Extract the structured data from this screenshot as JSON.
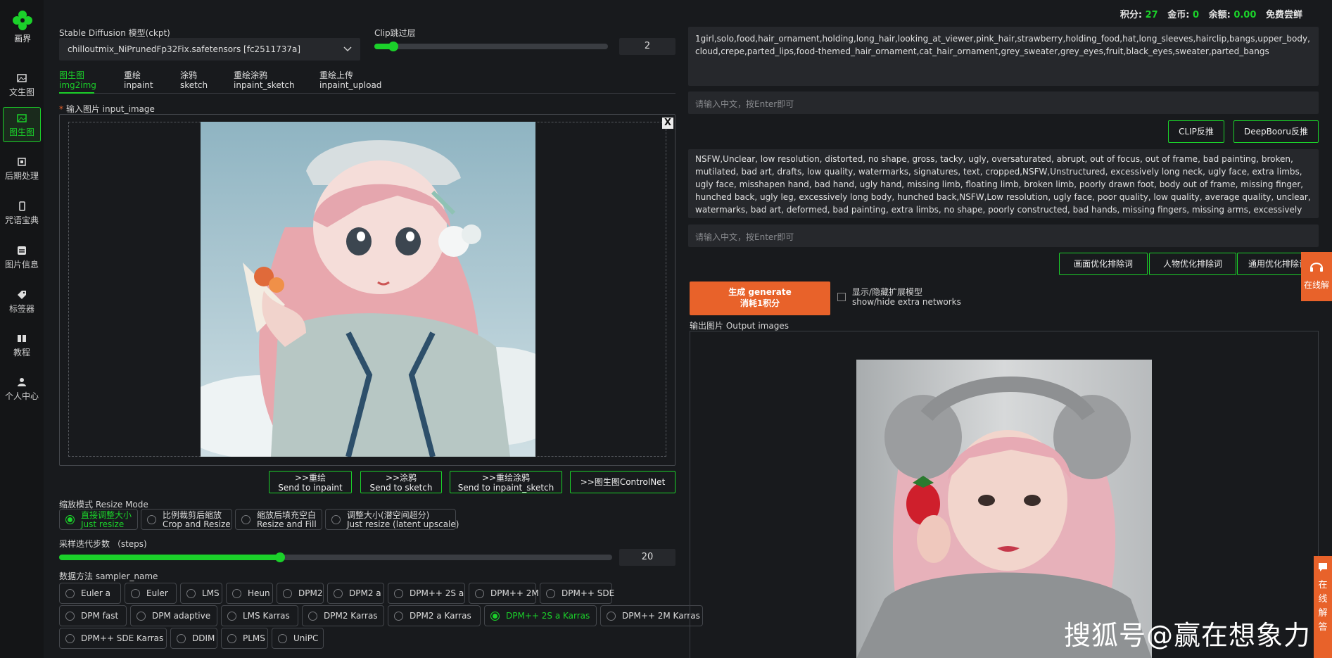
{
  "app": {
    "logo_text": "画界"
  },
  "sidebar": {
    "items": [
      {
        "label": "文生图",
        "icon": "image-icon"
      },
      {
        "label": "图生图",
        "icon": "image-icon",
        "active": true
      },
      {
        "label": "后期处理",
        "icon": "square-icon"
      },
      {
        "label": "咒语宝典",
        "icon": "phone-icon"
      },
      {
        "label": "图片信息",
        "icon": "layers-icon"
      },
      {
        "label": "标签器",
        "icon": "tag-icon"
      },
      {
        "label": "教程",
        "icon": "book-icon"
      },
      {
        "label": "个人中心",
        "icon": "user-icon"
      }
    ]
  },
  "topbar": {
    "points_label": "积分:",
    "points_value": "27",
    "gold_label": "金币:",
    "gold_value": "0",
    "balance_label": "余额:",
    "balance_value": "0.00",
    "free_trial": "免费尝鲜"
  },
  "model": {
    "label": "Stable Diffusion 模型(ckpt)",
    "value": "chilloutmix_NiPrunedFp32Fix.safetensors [fc2511737a]"
  },
  "clip": {
    "label": "Clip跳过层",
    "value": "2",
    "fraction": 0.08
  },
  "tabs": [
    {
      "line1": "图生图",
      "line2": "img2img",
      "active": true
    },
    {
      "line1": "重绘",
      "line2": "inpaint"
    },
    {
      "line1": "涂鸦",
      "line2": "sketch"
    },
    {
      "line1": "重绘涂鸦",
      "line2": "inpaint_sketch"
    },
    {
      "line1": "重绘上传",
      "line2": "inpaint_upload"
    }
  ],
  "input_image": {
    "required_mark": "*",
    "label": "输入图片 input_image",
    "close": "X"
  },
  "send_buttons": [
    {
      "line1": ">>重绘",
      "line2": "Send to inpaint"
    },
    {
      "line1": ">>涂鸦",
      "line2": "Send to sketch"
    },
    {
      "line1": ">>重绘涂鸦",
      "line2": "Send to inpaint_sketch"
    },
    {
      "line1": ">>图生图ControlNet",
      "line2": ""
    }
  ],
  "resize_mode": {
    "label": "缩放模式 Resize Mode",
    "options": [
      {
        "line1": "直接调整大小",
        "line2": "Just resize",
        "selected": true
      },
      {
        "line1": "比例裁剪后缩放",
        "line2": "Crop and Resize"
      },
      {
        "line1": "缩放后填充空白",
        "line2": "Resize and Fill"
      },
      {
        "line1": "调整大小(潜空间超分)",
        "line2": "Just resize (latent upscale)"
      }
    ]
  },
  "steps": {
    "label": "采样迭代步数 （steps)",
    "value": "20",
    "fraction": 0.4
  },
  "sampler": {
    "label": "数据方法 sampler_name",
    "rows": [
      [
        "Euler a",
        "Euler",
        "LMS",
        "Heun",
        "DPM2",
        "DPM2 a",
        "DPM++ 2S a",
        "DPM++ 2M",
        "DPM++ SDE"
      ],
      [
        "DPM fast",
        "DPM adaptive",
        "LMS Karras",
        "DPM2 Karras",
        "DPM2 a Karras",
        "DPM++ 2S a Karras",
        "DPM++ 2M Karras"
      ],
      [
        "DPM++ SDE Karras",
        "DDIM",
        "PLMS",
        "UniPC"
      ]
    ],
    "selected": "DPM++ 2S a Karras"
  },
  "prompt": {
    "value": "1girl,solo,food,hair_ornament,holding,long_hair,looking_at_viewer,pink_hair,strawberry,holding_food,hat,long_sleeves,hairclip,bangs,upper_body,cloud,crepe,parted_lips,food-themed_hair_ornament,cat_hair_ornament,grey_sweater,grey_eyes,fruit,black_eyes,sweater,parted_bangs",
    "cn_placeholder": "请输入中文，按Enter即可"
  },
  "interrogate": {
    "clip": "CLIP反推",
    "deepbooru": "DeepBooru反推"
  },
  "negative": {
    "value": "NSFW,Unclear, low resolution, distorted, no shape, gross, tacky, ugly, oversaturated, abrupt, out of focus, out of frame, bad painting, broken, mutilated, bad art, drafts, low quality, watermarks, signatures, text, cropped,NSFW,Unstructured, excessively long neck, ugly face, extra limbs, ugly face, misshapen hand, bad hand, ugly hand, missing limb, floating limb, broken limb, poorly drawn foot, body out of frame, missing finger, hunched back, ugly leg, excessively long body, hunched back,NSFW,Low resolution, ugly face, poor quality, low quality, average quality, unclear, watermarks, bad art, deformed, bad painting, extra limbs, no shape, poorly constructed, bad hands, missing fingers, missing arms, excessively long neck,",
    "cn_placeholder": "请输入中文，按Enter即可"
  },
  "neg_buttons": [
    "画面优化排除词",
    "人物优化排除词",
    "通用优化排除词"
  ],
  "generate": {
    "line1": "生成 generate",
    "line2": "消耗1积分"
  },
  "extra_networks": {
    "line1": "显示/隐藏扩展模型",
    "line2": "show/hide extra networks"
  },
  "output": {
    "label": "输出图片 Output images"
  },
  "float": {
    "online": "在线解",
    "chat": "在线解答"
  },
  "watermark": "搜狐号@赢在想象力",
  "colors": {
    "accent": "#1bd12a",
    "orange": "#e8622a",
    "bg": "#181a1d"
  }
}
